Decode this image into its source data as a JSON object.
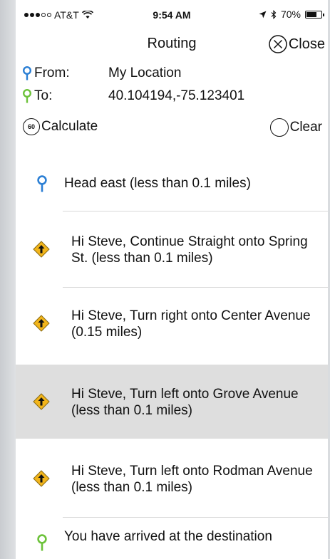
{
  "status_bar": {
    "carrier": "AT&T",
    "time": "9:54 AM",
    "battery": "70%",
    "battery_level": 0.7
  },
  "nav": {
    "title": "Routing",
    "close_label": "Close"
  },
  "route": {
    "from_label": "From:",
    "from_value": "My Location",
    "to_label": "To:",
    "to_value": "40.104194,-75.123401"
  },
  "actions": {
    "calculate_badge": "60",
    "calculate_label": "Calculate",
    "clear_label": "Clear"
  },
  "colors": {
    "from_pin": "#2b7fd4",
    "to_pin": "#6cc23a",
    "turn_sign": "#f2b51b",
    "highlight": "#dedede"
  },
  "steps": [
    {
      "icon": "blue-pin-icon",
      "text": "Head east (less than 0.1 miles)"
    },
    {
      "icon": "turn-sign-icon",
      "text": "Hi Steve, Continue Straight onto Spring St. (less than 0.1 miles)"
    },
    {
      "icon": "turn-sign-icon",
      "text": "Hi Steve, Turn right onto Center Avenue (0.15 miles)"
    },
    {
      "icon": "turn-sign-icon",
      "text": "Hi Steve, Turn left onto Grove Avenue (less than 0.1 miles)",
      "selected": true
    },
    {
      "icon": "turn-sign-icon",
      "text": "Hi Steve, Turn left onto Rodman Avenue (less than 0.1 miles)"
    },
    {
      "icon": "green-pin-icon",
      "text": "You have arrived at the destination"
    }
  ]
}
